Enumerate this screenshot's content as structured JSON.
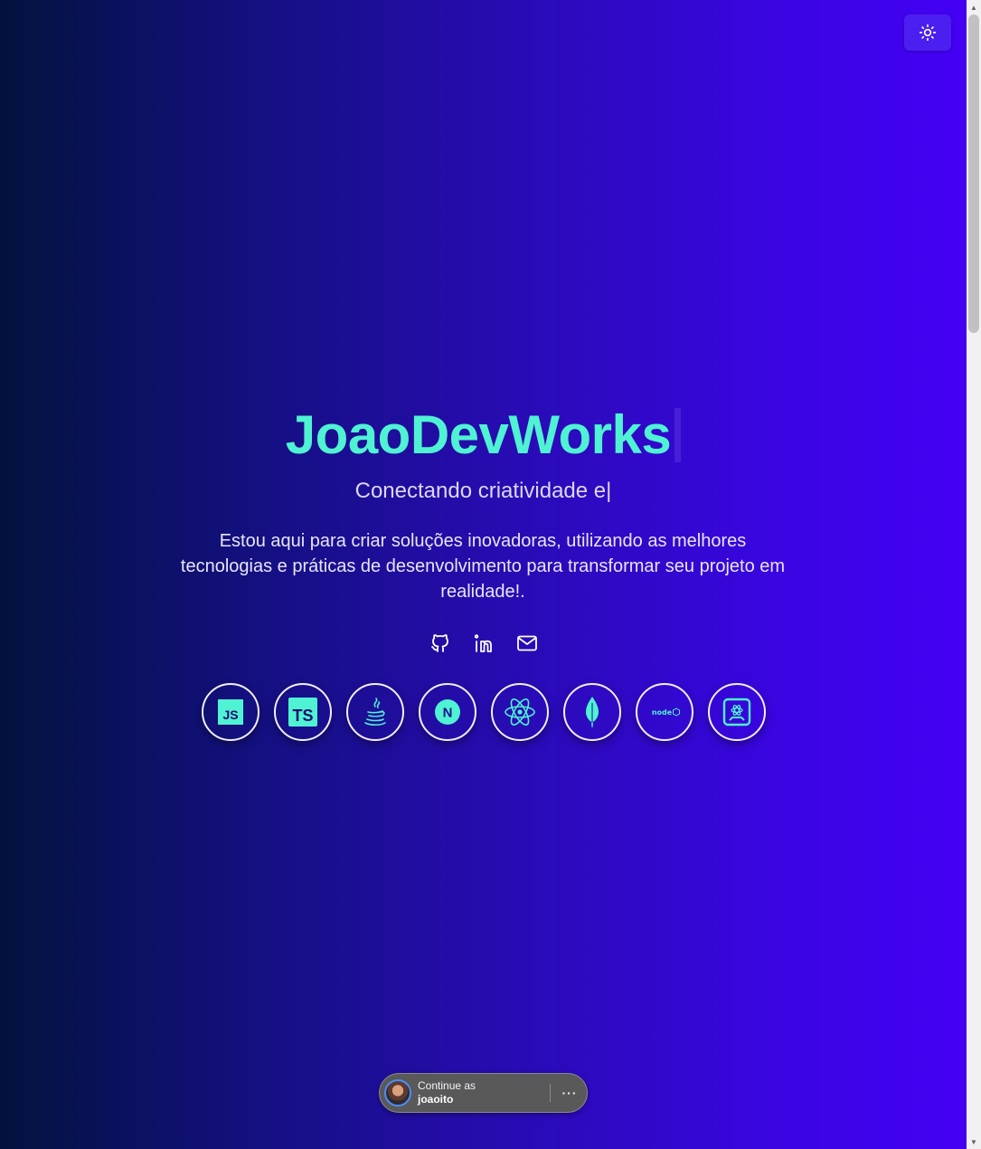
{
  "hero": {
    "title": "JoaoDevWorks",
    "subtitle": "Conectando criatividade e|",
    "description": "Estou aqui para criar soluções inovadoras, utilizando as melhores tecnologias e práticas de desenvolvimento para transformar seu projeto em realidade!."
  },
  "colors": {
    "accent": "#4ff2d2",
    "gradient_start": "#02123d",
    "gradient_end": "#4400f5",
    "toggle_bg": "#4b1ff0"
  },
  "theme_toggle": {
    "icon": "sun-icon"
  },
  "socials": [
    {
      "name": "github",
      "icon": "github-icon"
    },
    {
      "name": "linkedin",
      "icon": "linkedin-icon"
    },
    {
      "name": "email",
      "icon": "mail-icon"
    }
  ],
  "technologies": [
    {
      "name": "javascript",
      "icon": "javascript-icon",
      "label": "JS"
    },
    {
      "name": "typescript",
      "icon": "typescript-icon",
      "label": "TS"
    },
    {
      "name": "java",
      "icon": "java-icon"
    },
    {
      "name": "nextjs",
      "icon": "nextjs-icon",
      "label": "N"
    },
    {
      "name": "react",
      "icon": "react-icon"
    },
    {
      "name": "mongodb",
      "icon": "mongodb-icon"
    },
    {
      "name": "nodejs",
      "icon": "nodejs-icon",
      "label": "node"
    },
    {
      "name": "react-native",
      "icon": "react-native-icon"
    }
  ],
  "one_tap": {
    "line1": "Continue as",
    "user": "joaoito",
    "more_label": "···"
  }
}
